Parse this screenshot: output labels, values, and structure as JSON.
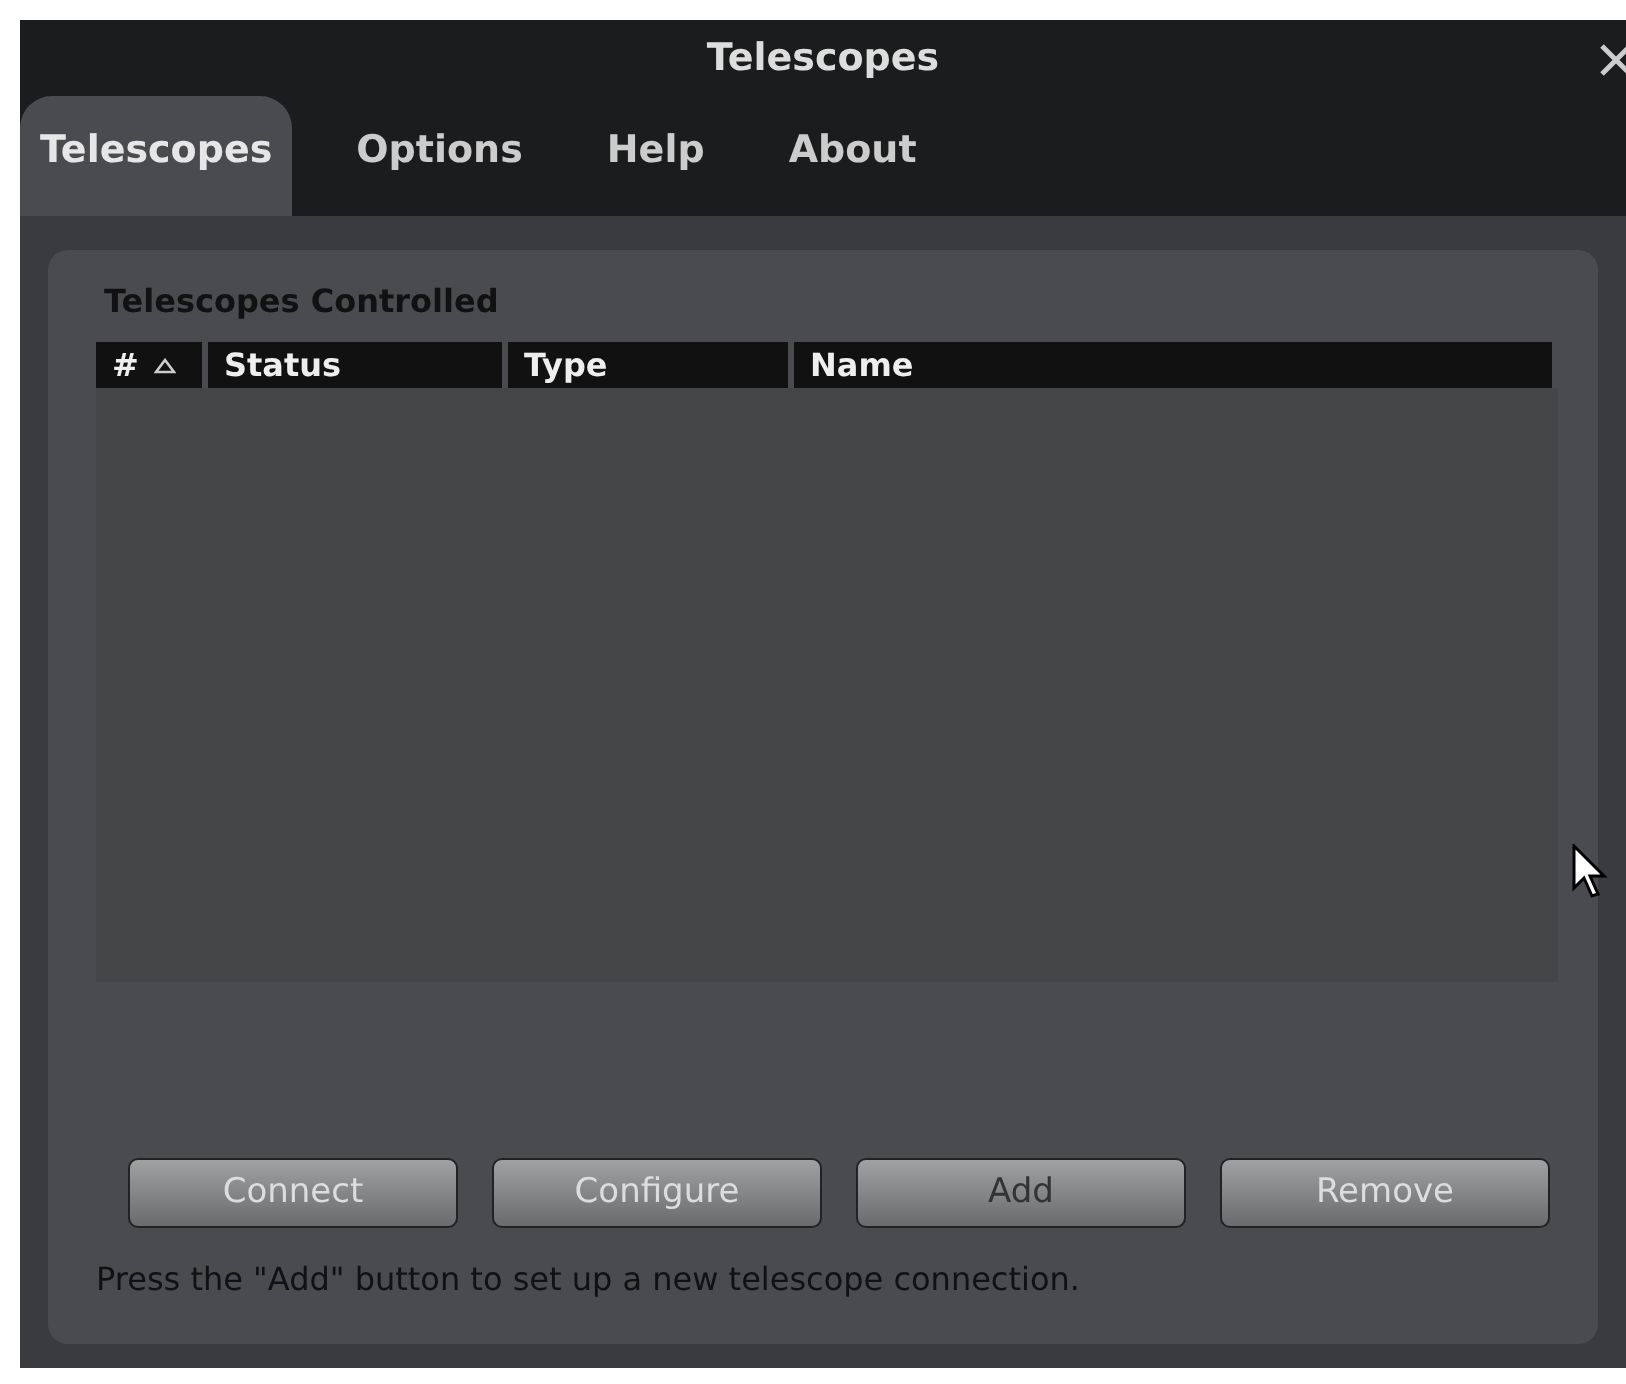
{
  "window": {
    "title": "Telescopes"
  },
  "tabs": [
    {
      "label": "Telescopes",
      "selected": true
    },
    {
      "label": "Options",
      "selected": false
    },
    {
      "label": "Help",
      "selected": false
    },
    {
      "label": "About",
      "selected": false
    }
  ],
  "group": {
    "title": "Telescopes Controlled"
  },
  "table": {
    "columns": [
      {
        "label": "#",
        "sorted": true
      },
      {
        "label": "Status",
        "sorted": false
      },
      {
        "label": "Type",
        "sorted": false
      },
      {
        "label": "Name",
        "sorted": false
      }
    ]
  },
  "buttons": [
    {
      "label": "Connect",
      "disabled": true
    },
    {
      "label": "Configure",
      "disabled": true
    },
    {
      "label": "Add",
      "disabled": false
    },
    {
      "label": "Remove",
      "disabled": true
    }
  ],
  "status_bar": "Press the \"Add\" button to set up a new telescope connection."
}
